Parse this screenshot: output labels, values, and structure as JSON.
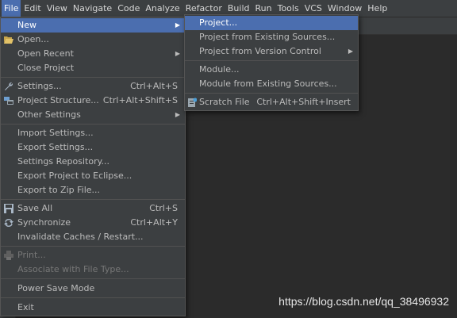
{
  "menubar": {
    "items": [
      "File",
      "Edit",
      "View",
      "Navigate",
      "Code",
      "Analyze",
      "Refactor",
      "Build",
      "Run",
      "Tools",
      "VCS",
      "Window",
      "Help"
    ],
    "active_index": 0
  },
  "file_menu": {
    "items": [
      {
        "label": "New",
        "shortcut": "",
        "submenu": true,
        "icon": "",
        "highlight": true
      },
      {
        "label": "Open...",
        "shortcut": "",
        "submenu": false,
        "icon": "folder-open-icon"
      },
      {
        "label": "Open Recent",
        "shortcut": "",
        "submenu": true,
        "icon": ""
      },
      {
        "label": "Close Project",
        "shortcut": "",
        "submenu": false,
        "icon": ""
      },
      {
        "label": "Settings...",
        "shortcut": "Ctrl+Alt+S",
        "submenu": false,
        "icon": "wrench-icon"
      },
      {
        "label": "Project Structure...",
        "shortcut": "Ctrl+Alt+Shift+S",
        "submenu": false,
        "icon": "project-structure-icon"
      },
      {
        "label": "Other Settings",
        "shortcut": "",
        "submenu": true,
        "icon": ""
      },
      {
        "label": "Import Settings...",
        "shortcut": "",
        "submenu": false,
        "icon": ""
      },
      {
        "label": "Export Settings...",
        "shortcut": "",
        "submenu": false,
        "icon": ""
      },
      {
        "label": "Settings Repository...",
        "shortcut": "",
        "submenu": false,
        "icon": ""
      },
      {
        "label": "Export Project to Eclipse...",
        "shortcut": "",
        "submenu": false,
        "icon": ""
      },
      {
        "label": "Export to Zip File...",
        "shortcut": "",
        "submenu": false,
        "icon": ""
      },
      {
        "label": "Save All",
        "shortcut": "Ctrl+S",
        "submenu": false,
        "icon": "floppy-icon"
      },
      {
        "label": "Synchronize",
        "shortcut": "Ctrl+Alt+Y",
        "submenu": false,
        "icon": "sync-icon"
      },
      {
        "label": "Invalidate Caches / Restart...",
        "shortcut": "",
        "submenu": false,
        "icon": ""
      },
      {
        "label": "Print...",
        "shortcut": "",
        "submenu": false,
        "icon": "printer-icon",
        "disabled": true
      },
      {
        "label": "Associate with File Type...",
        "shortcut": "",
        "submenu": false,
        "icon": "",
        "disabled": true
      },
      {
        "label": "Power Save Mode",
        "shortcut": "",
        "submenu": false,
        "icon": ""
      },
      {
        "label": "Exit",
        "shortcut": "",
        "submenu": false,
        "icon": ""
      }
    ]
  },
  "new_submenu": {
    "items": [
      {
        "label": "Project...",
        "shortcut": "",
        "submenu": false,
        "highlight": true
      },
      {
        "label": "Project from Existing Sources...",
        "shortcut": "",
        "submenu": false
      },
      {
        "label": "Project from Version Control",
        "shortcut": "",
        "submenu": true
      },
      {
        "label": "Module...",
        "shortcut": "",
        "submenu": false
      },
      {
        "label": "Module from Existing Sources...",
        "shortcut": "",
        "submenu": false
      },
      {
        "label": "Scratch File",
        "shortcut": "Ctrl+Alt+Shift+Insert",
        "submenu": false,
        "icon": "scratch-file-icon"
      }
    ]
  },
  "watermark": "https://blog.csdn.net/qq_38496932",
  "colors": {
    "menubar_bg": "#3c3f41",
    "editor_bg": "#2b2b2b",
    "highlight": "#4b6eaf",
    "text": "#bbbbbb",
    "disabled_text": "#777777"
  }
}
